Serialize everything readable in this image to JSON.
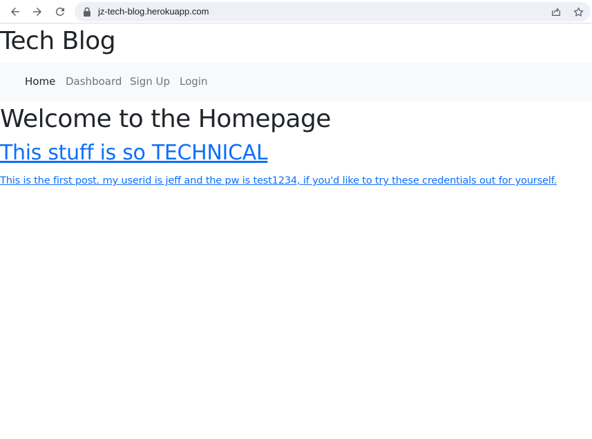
{
  "browser": {
    "url": "jz-tech-blog.herokuapp.com",
    "icons": [
      "back-arrow-icon",
      "forward-arrow-icon",
      "reload-icon",
      "lock-icon",
      "share-icon",
      "star-icon"
    ]
  },
  "site": {
    "title": "Tech Blog"
  },
  "nav": {
    "items": [
      {
        "label": "Home",
        "active": true
      },
      {
        "label": "Dashboard",
        "active": false
      },
      {
        "label": "Sign Up",
        "active": false
      },
      {
        "label": "Login",
        "active": false
      }
    ]
  },
  "main": {
    "heading": "Welcome to the Homepage",
    "posts": [
      {
        "title": "This stuff is so TECHNICAL",
        "body": "This is the first post. my userid is jeff and the pw is test1234, if you'd like to try these credentials out for yourself."
      }
    ]
  },
  "colors": {
    "link": "#0d6efd",
    "navbar_bg": "#f8f9fa",
    "text": "#212529",
    "nav_muted": "#6c757d"
  }
}
